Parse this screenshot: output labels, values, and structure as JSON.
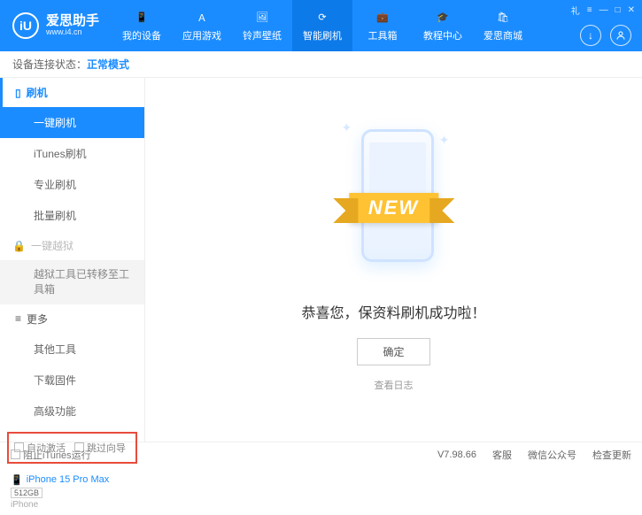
{
  "header": {
    "logo_letter": "iU",
    "app_title": "爱思助手",
    "app_url": "www.i4.cn",
    "nav": [
      {
        "label": "我的设备"
      },
      {
        "label": "应用游戏"
      },
      {
        "label": "铃声壁纸"
      },
      {
        "label": "智能刷机"
      },
      {
        "label": "工具箱"
      },
      {
        "label": "教程中心"
      },
      {
        "label": "爱思商城"
      }
    ],
    "win_controls": {
      "gift": "礼",
      "menu": "≡",
      "min": "—",
      "max": "□",
      "close": "✕"
    },
    "circle_download": "↓",
    "circle_user": "◯"
  },
  "status": {
    "prefix": "设备连接状态：",
    "mode": "正常模式"
  },
  "sidebar": {
    "flash_head": "刷机",
    "flash_items": [
      "一键刷机",
      "iTunes刷机",
      "专业刷机",
      "批量刷机"
    ],
    "jailbreak_head": "一键越狱",
    "jailbreak_note": "越狱工具已转移至工具箱",
    "more_head": "更多",
    "more_items": [
      "其他工具",
      "下载固件",
      "高级功能"
    ],
    "checkboxes": {
      "auto_activate": "自动激活",
      "skip_guide": "跳过向导"
    },
    "device": {
      "name": "iPhone 15 Pro Max",
      "storage": "512GB",
      "type": "iPhone"
    }
  },
  "main": {
    "ribbon": "NEW",
    "success": "恭喜您，保资料刷机成功啦！",
    "confirm": "确定",
    "view_log": "查看日志"
  },
  "footer": {
    "block_itunes": "阻止iTunes运行",
    "version": "V7.98.66",
    "links": [
      "客服",
      "微信公众号",
      "检查更新"
    ]
  }
}
